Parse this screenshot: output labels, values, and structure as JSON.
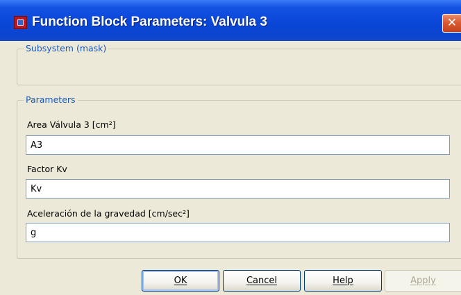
{
  "window": {
    "title": "Function Block Parameters: Valvula 3",
    "close_glyph": "✕",
    "icon": "simulink-block-icon"
  },
  "subsystem": {
    "legend": "Subsystem (mask)"
  },
  "parameters": {
    "legend": "Parameters",
    "fields": [
      {
        "label": "Area Válvula 3 [cm²]",
        "value": "A3"
      },
      {
        "label": "Factor Kv",
        "value": "Kv"
      },
      {
        "label": "Aceleración de la gravedad [cm/sec²]",
        "value": "g"
      }
    ]
  },
  "buttons": {
    "ok": "OK",
    "cancel": "Cancel",
    "help": "Help",
    "apply": "Apply"
  }
}
